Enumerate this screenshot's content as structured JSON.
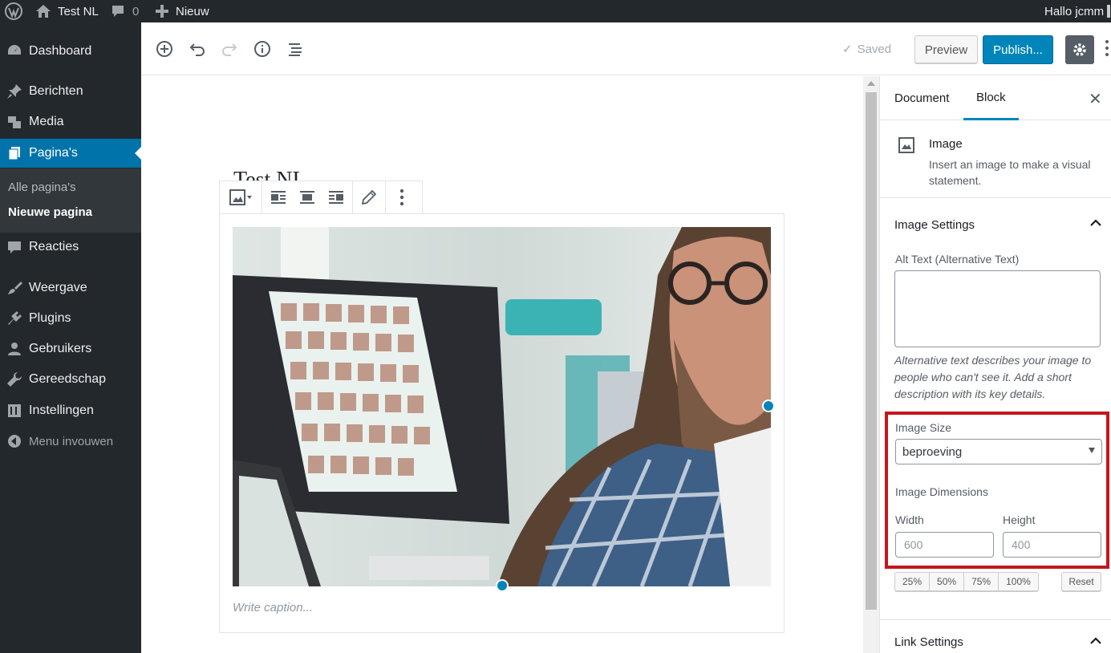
{
  "adminbar": {
    "site_name": "Test NL",
    "comments_count": "0",
    "new_label": "Nieuw",
    "greeting": "Hallo jcmm"
  },
  "sidebar": {
    "items": [
      {
        "label": "Dashboard",
        "icon": "dashboard-icon"
      },
      {
        "label": "Berichten",
        "icon": "pin-icon"
      },
      {
        "label": "Media",
        "icon": "media-icon"
      },
      {
        "label": "Pagina's",
        "icon": "pages-icon",
        "active": true
      },
      {
        "label": "Reacties",
        "icon": "comment-icon"
      },
      {
        "label": "Weergave",
        "icon": "brush-icon"
      },
      {
        "label": "Plugins",
        "icon": "plugin-icon"
      },
      {
        "label": "Gebruikers",
        "icon": "user-icon"
      },
      {
        "label": "Gereedschap",
        "icon": "wrench-icon"
      },
      {
        "label": "Instellingen",
        "icon": "settings-icon"
      }
    ],
    "submenu": [
      "Alle pagina's",
      "Nieuwe pagina"
    ],
    "collapse_label": "Menu invouwen"
  },
  "header": {
    "saved_label": "Saved",
    "preview_label": "Preview",
    "publish_label": "Publish..."
  },
  "editor": {
    "page_title": "Test NL",
    "caption_placeholder": "Write caption..."
  },
  "settings": {
    "tabs": [
      "Document",
      "Block"
    ],
    "active_tab": "Block",
    "block_name": "Image",
    "block_description": "Insert an image to make a visual statement.",
    "image_settings_title": "Image Settings",
    "alt_text_label": "Alt Text (Alternative Text)",
    "alt_text_value": "",
    "alt_text_help": "Alternative text describes your image to people who can't see it. Add a short description with its key details.",
    "image_size_label": "Image Size",
    "image_size_value": "beproeving",
    "dimensions_label": "Image Dimensions",
    "width_label": "Width",
    "height_label": "Height",
    "width_placeholder": "600",
    "height_placeholder": "400",
    "percent_buttons": [
      "25%",
      "50%",
      "75%",
      "100%"
    ],
    "reset_label": "Reset",
    "link_settings_title": "Link Settings"
  },
  "colors": {
    "admin_dark": "#23282d",
    "accent": "#0073aa",
    "publish": "#0085ba",
    "highlight": "#c4161c"
  }
}
